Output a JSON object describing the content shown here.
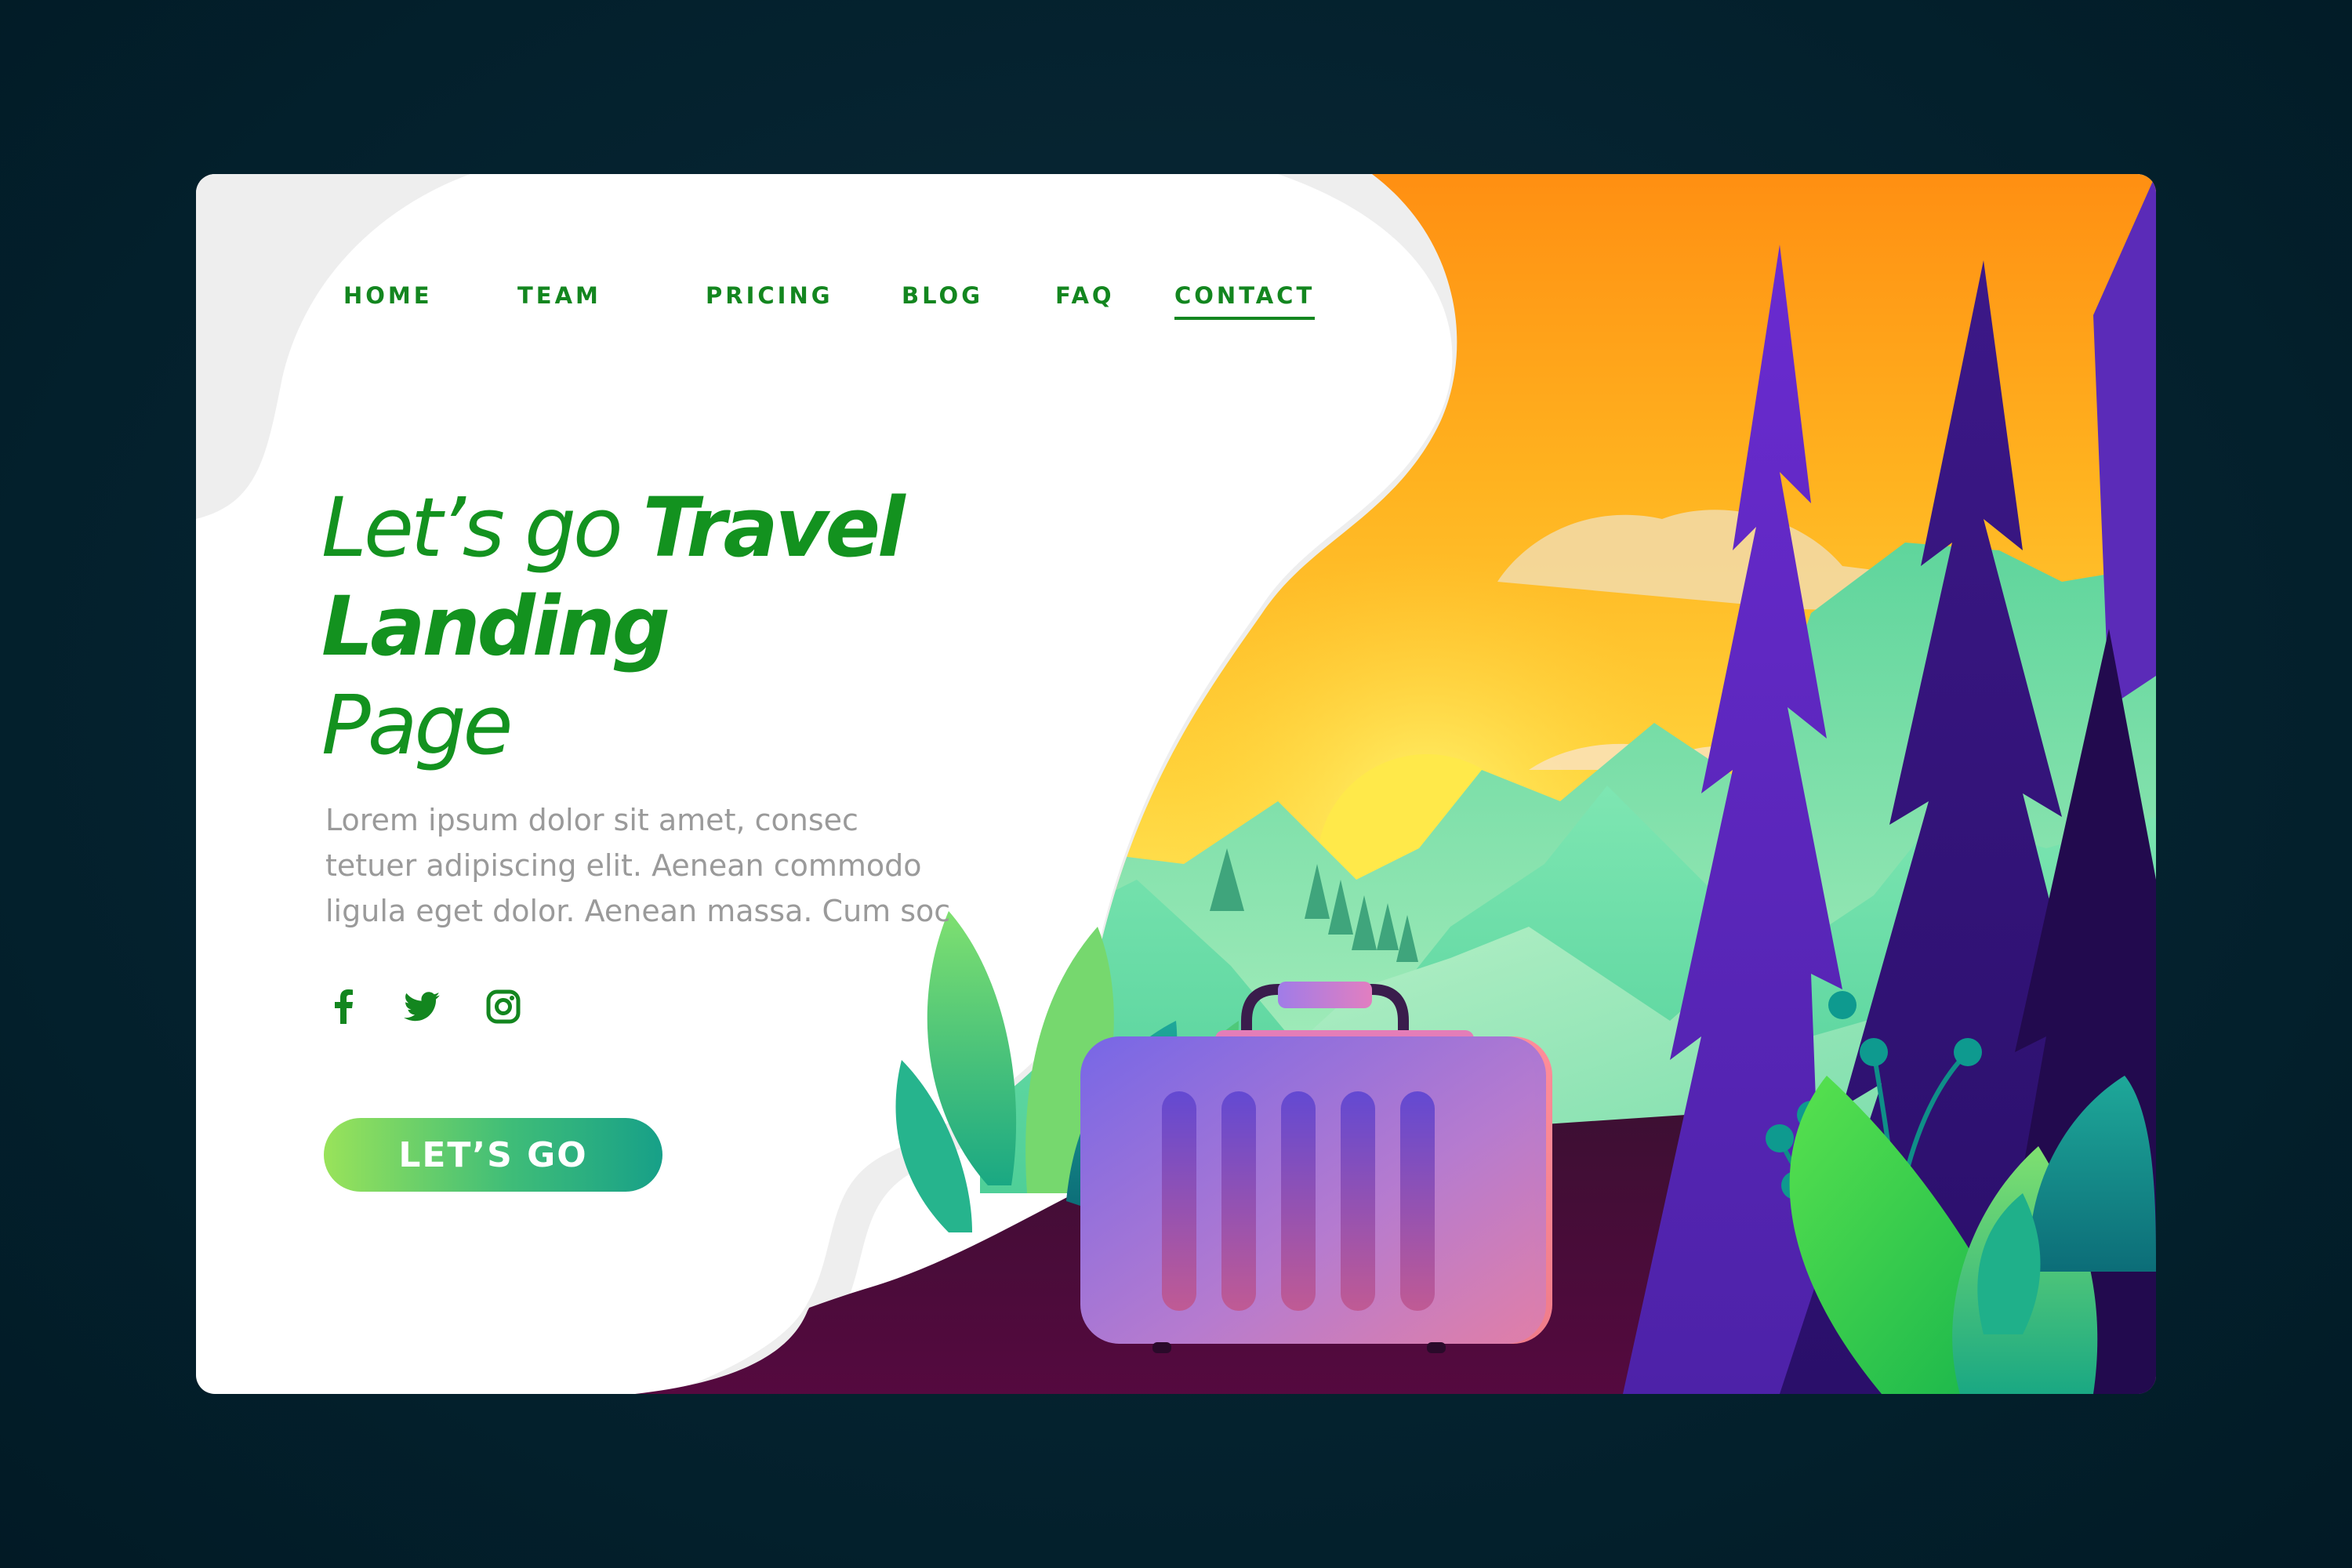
{
  "nav": {
    "items": [
      {
        "label": "HOME",
        "active": false
      },
      {
        "label": "TEAM",
        "active": false
      },
      {
        "label": "PRICING",
        "active": false
      },
      {
        "label": "BLOG",
        "active": false
      },
      {
        "label": "FAQ",
        "active": false
      },
      {
        "label": "CONTACT",
        "active": true
      }
    ]
  },
  "hero": {
    "title_part1": "Let’s go ",
    "title_part2": "Travel",
    "title_part3": "Landing",
    "title_part4": "Page",
    "body_line1": "Lorem ipsum dolor sit amet, consec",
    "body_line2": "tetuer adipiscing elit. Aenean commodo",
    "body_line3": "ligula eget dolor. Aenean massa. Cum soc",
    "cta_label": "LET’S GO"
  },
  "socials": [
    {
      "icon": "facebook-icon"
    },
    {
      "icon": "twitter-icon"
    },
    {
      "icon": "instagram-icon"
    }
  ],
  "colors": {
    "brand_green": "#13861f",
    "page_background": "#03202c",
    "sky_orange": "#ff9a1e",
    "sky_yellow": "#ffd23a",
    "tree_purple": "#4a1f9a",
    "suitcase": "#9d7fe0"
  }
}
